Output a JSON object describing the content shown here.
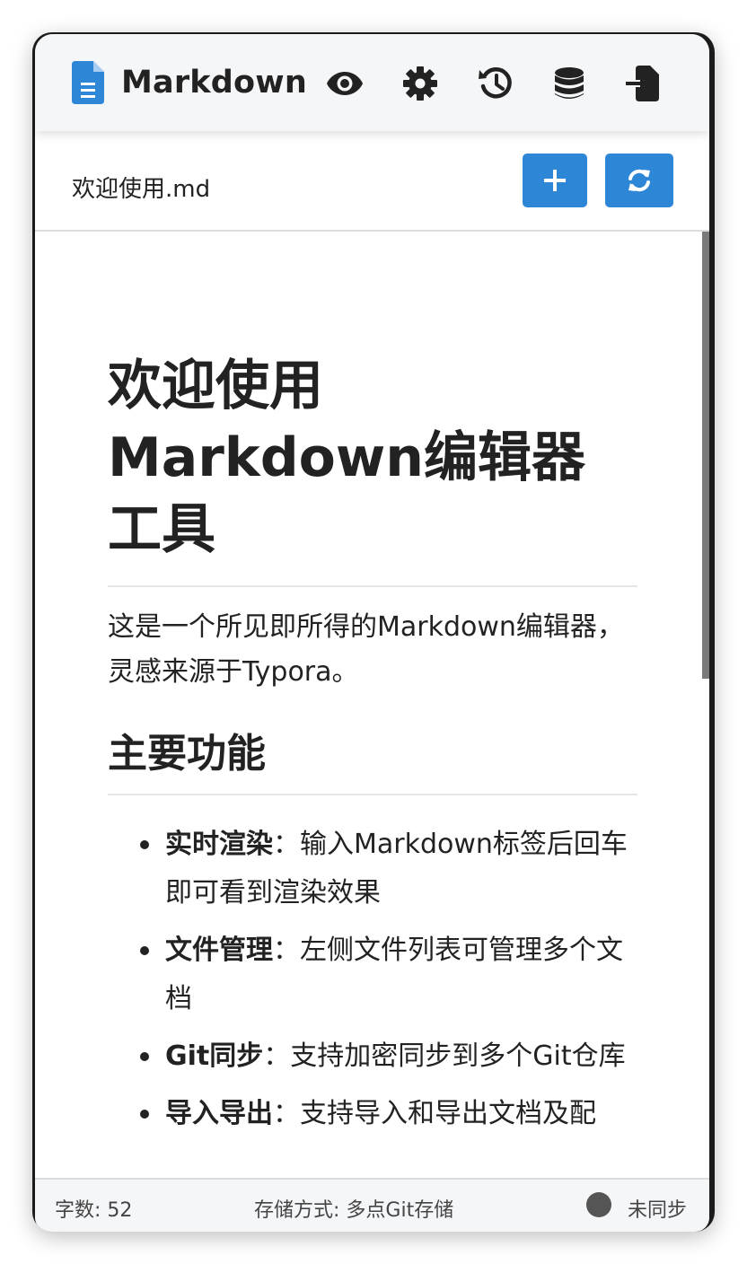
{
  "header": {
    "title": "Markdown",
    "buttons": [
      {
        "name": "preview",
        "icon": "eye-icon"
      },
      {
        "name": "settings",
        "icon": "gear-icon"
      },
      {
        "name": "history",
        "icon": "history-icon"
      },
      {
        "name": "storage",
        "icon": "database-icon"
      },
      {
        "name": "import",
        "icon": "file-import-icon"
      }
    ]
  },
  "filebar": {
    "filename": "欢迎使用.md",
    "buttons": [
      {
        "name": "new-file",
        "icon": "plus-icon"
      },
      {
        "name": "sync",
        "icon": "refresh-icon"
      }
    ]
  },
  "document": {
    "h1": "欢迎使用Markdown编辑器工具",
    "intro": "这是一个所见即所得的Markdown编辑器，灵感来源于Typora。",
    "h2": "主要功能",
    "features": [
      {
        "title": "实时渲染",
        "sep": "：",
        "desc": "输入Markdown标签后回车即可看到渲染效果"
      },
      {
        "title": "文件管理",
        "sep": "：",
        "desc": "左侧文件列表可管理多个文档"
      },
      {
        "title": "Git同步",
        "sep": "：",
        "desc": "支持加密同步到多个Git仓库"
      },
      {
        "title": "导入导出",
        "sep": "：",
        "desc": "支持导入和导出文档及配"
      }
    ]
  },
  "status": {
    "word_count": "字数: 52",
    "storage": "存储方式: 多点Git存储",
    "sync_state": "未同步"
  },
  "colors": {
    "accent": "#2e86d6",
    "header_bg": "#f5f6f8",
    "text": "#222222",
    "status_dot": "#555555"
  }
}
